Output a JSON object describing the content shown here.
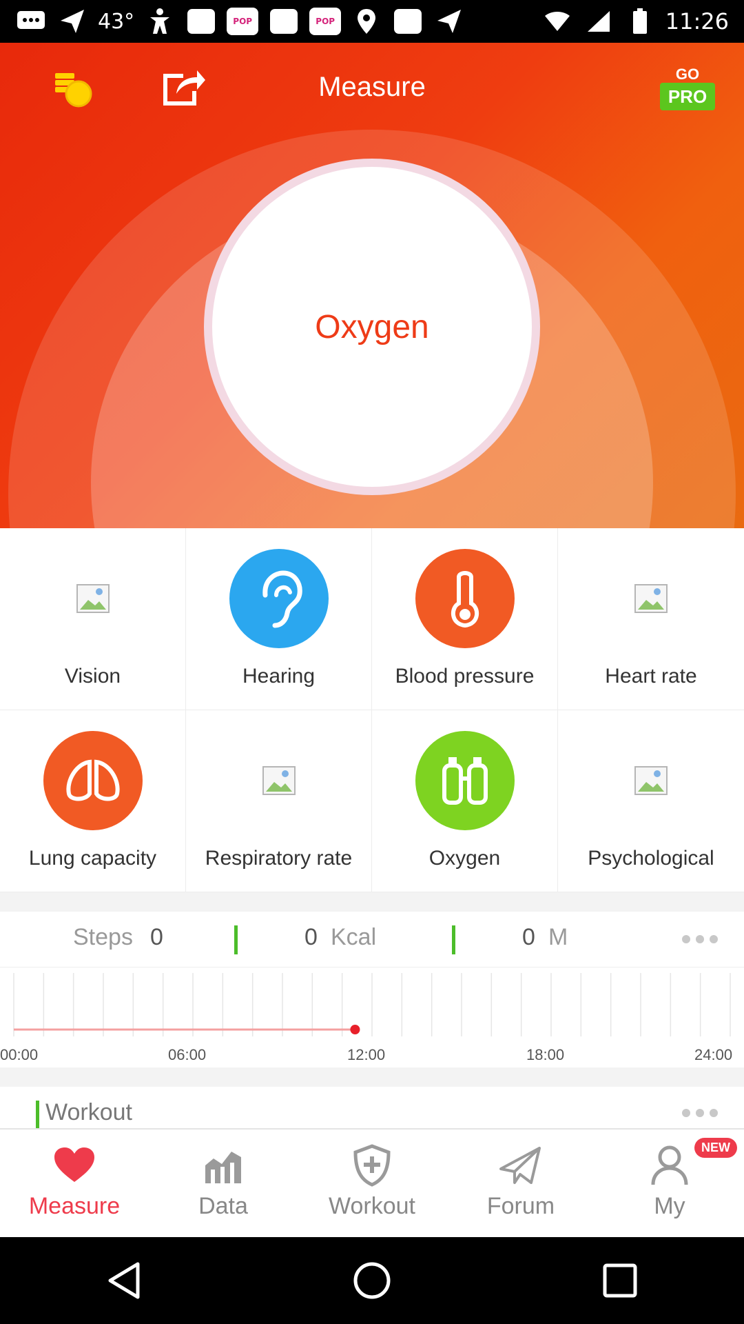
{
  "status_bar": {
    "temperature": "43°",
    "time": "11:26",
    "pop_label": "POP"
  },
  "header": {
    "title": "Measure",
    "go_label": "GO",
    "pro_label": "PRO"
  },
  "hero": {
    "measure_button_label": "Oxygen"
  },
  "tests": [
    {
      "label": "Vision",
      "icon": "image-placeholder-icon"
    },
    {
      "label": "Hearing",
      "icon": "ear-icon",
      "color": "#2ba7ef"
    },
    {
      "label": "Blood pressure",
      "icon": "thermometer-icon",
      "color": "#f15a24"
    },
    {
      "label": "Heart rate",
      "icon": "image-placeholder-icon"
    },
    {
      "label": "Lung capacity",
      "icon": "lungs-icon",
      "color": "#f15a24"
    },
    {
      "label": "Respiratory rate",
      "icon": "image-placeholder-icon"
    },
    {
      "label": "Oxygen",
      "icon": "oxygen-tanks-icon",
      "color": "#7ed321"
    },
    {
      "label": "Psychological",
      "icon": "image-placeholder-icon"
    }
  ],
  "stats": {
    "steps_label": "Steps",
    "steps_value": "0",
    "kcal_value": "0",
    "kcal_label": "Kcal",
    "distance_value": "0",
    "distance_label": "M"
  },
  "chart_data": {
    "type": "line",
    "x_ticks": [
      "00:00",
      "06:00",
      "12:00",
      "18:00",
      "24:00"
    ],
    "x": [
      "00:00",
      "11:26"
    ],
    "values": [
      0,
      0
    ],
    "current_time_marker": "11:26"
  },
  "workout": {
    "title": "Workout"
  },
  "tabbar": [
    {
      "label": "Measure",
      "icon": "heart-icon",
      "active": true
    },
    {
      "label": "Data",
      "icon": "chart-icon",
      "active": false
    },
    {
      "label": "Workout",
      "icon": "shield-plus-icon",
      "active": false
    },
    {
      "label": "Forum",
      "icon": "paper-plane-icon",
      "active": false
    },
    {
      "label": "My",
      "icon": "person-icon",
      "active": false,
      "badge": "NEW"
    }
  ],
  "colors": {
    "brand": "#ee3b17",
    "accent_green": "#4cbd2a",
    "active_tab": "#ee3b4b"
  }
}
